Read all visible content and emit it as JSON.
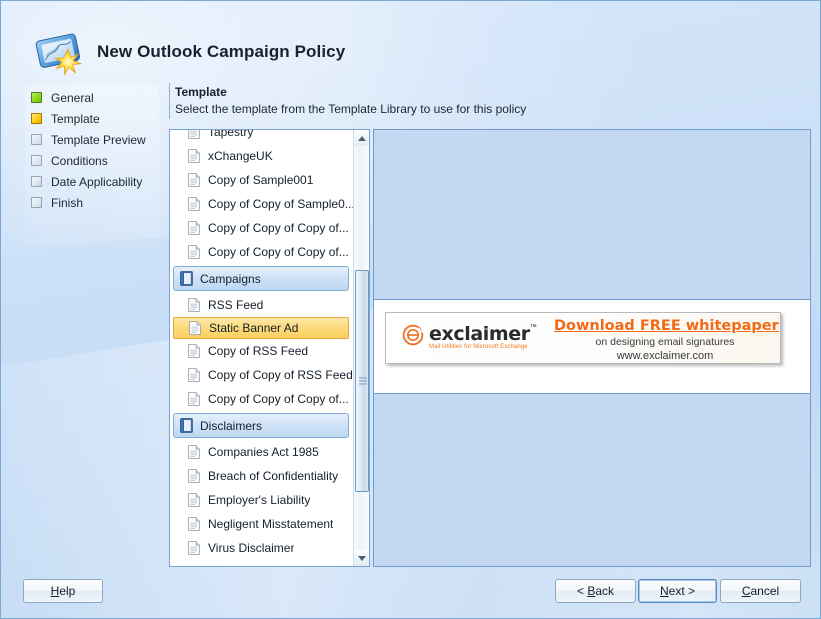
{
  "window": {
    "title": "New Outlook Campaign Policy",
    "app_icon": "outlook-campaign-icon"
  },
  "sidebar": {
    "items": [
      {
        "label": "General",
        "state": "done"
      },
      {
        "label": "Template",
        "state": "current"
      },
      {
        "label": "Template Preview",
        "state": "todo"
      },
      {
        "label": "Conditions",
        "state": "todo"
      },
      {
        "label": "Date Applicability",
        "state": "todo"
      },
      {
        "label": "Finish",
        "state": "todo"
      }
    ]
  },
  "content_header": {
    "title": "Template",
    "subtitle": "Select the template from the Template Library to use for this policy"
  },
  "template_list": {
    "rows": [
      {
        "type": "item",
        "label": "Tapestry",
        "selected": false
      },
      {
        "type": "item",
        "label": "xChangeUK",
        "selected": false
      },
      {
        "type": "item",
        "label": "Copy of Sample001",
        "selected": false
      },
      {
        "type": "item",
        "label": "Copy of Copy of Sample0...",
        "selected": false
      },
      {
        "type": "item",
        "label": "Copy of Copy of Copy of...",
        "selected": false
      },
      {
        "type": "item",
        "label": "Copy of Copy of Copy of...",
        "selected": false
      },
      {
        "type": "group",
        "label": "Campaigns"
      },
      {
        "type": "item",
        "label": "RSS Feed",
        "selected": false
      },
      {
        "type": "item",
        "label": "Static Banner Ad",
        "selected": true
      },
      {
        "type": "item",
        "label": "Copy of RSS Feed",
        "selected": false
      },
      {
        "type": "item",
        "label": "Copy of Copy of RSS Feed",
        "selected": false
      },
      {
        "type": "item",
        "label": "Copy of Copy of Copy of...",
        "selected": false
      },
      {
        "type": "group",
        "label": "Disclaimers"
      },
      {
        "type": "item",
        "label": "Companies Act 1985",
        "selected": false
      },
      {
        "type": "item",
        "label": "Breach of Confidentiality",
        "selected": false
      },
      {
        "type": "item",
        "label": "Employer's Liability",
        "selected": false
      },
      {
        "type": "item",
        "label": "Negligent Misstatement",
        "selected": false
      },
      {
        "type": "item",
        "label": "Virus Disclaimer",
        "selected": false
      }
    ],
    "scrollbar": {
      "up_icon": "scroll-up-arrow-icon",
      "down_icon": "scroll-down-arrow-icon"
    }
  },
  "preview": {
    "banner": {
      "logo_word": "exclaimer",
      "logo_tm": "™",
      "logo_tagline": "Mail Utilities for Microsoft Exchange",
      "headline": "Download FREE whitepaper",
      "subline1": "on designing email signatures",
      "subline2": "www.exclaimer.com"
    }
  },
  "footer": {
    "help": {
      "pre": "",
      "accel": "H",
      "post": "elp"
    },
    "back": {
      "pre": "< ",
      "accel": "B",
      "post": "ack"
    },
    "next": {
      "pre": "",
      "accel": "N",
      "post": "ext >"
    },
    "cancel": {
      "pre": "",
      "accel": "C",
      "post": "ancel"
    }
  },
  "colors": {
    "accent_orange": "#f26a18",
    "selection_amber": "#fcd97a",
    "panel_blue": "#c3d9f2",
    "window_blue": "#c5dcf6"
  }
}
